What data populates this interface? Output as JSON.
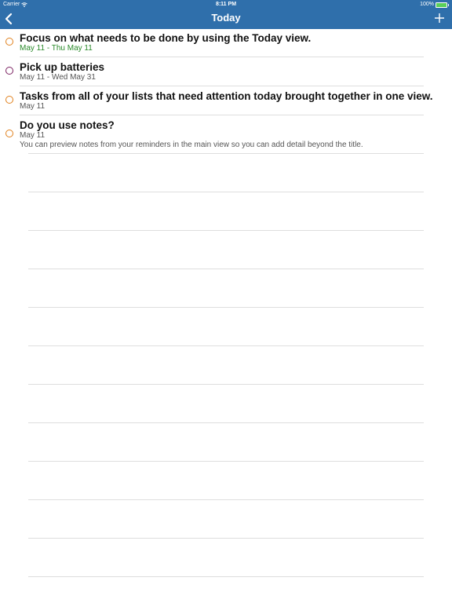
{
  "status_bar": {
    "carrier": "Carrier",
    "time": "8:11 PM",
    "battery": "100%",
    "battery_level": 1.0
  },
  "nav": {
    "title": "Today",
    "back_icon": "chevron-left-icon",
    "add_icon": "plus-icon"
  },
  "colors": {
    "header_bg": "#2f6fab",
    "circle_orange": "#e0801c",
    "circle_purple": "#7a2060",
    "date_green": "#2a8a2a"
  },
  "reminders": [
    {
      "title": "Focus on what needs to be done by using the Today view.",
      "date": "May 11 - Thu May 11",
      "note": "",
      "circle_color": "#e0801c",
      "date_color": "#2a8a2a"
    },
    {
      "title": "Pick up batteries",
      "date": "May 11 - Wed May 31",
      "note": "",
      "circle_color": "#7a2060",
      "date_color": "#555555"
    },
    {
      "title": "Tasks from all of your lists that need attention today brought together in one view.",
      "date": "May 11",
      "note": "",
      "circle_color": "#e0801c",
      "date_color": "#555555"
    },
    {
      "title": "Do you use notes?",
      "date": "May 11",
      "note": "You can preview notes from your reminders in the main view so you can add detail beyond the title.",
      "circle_color": "#e0801c",
      "date_color": "#555555"
    }
  ]
}
